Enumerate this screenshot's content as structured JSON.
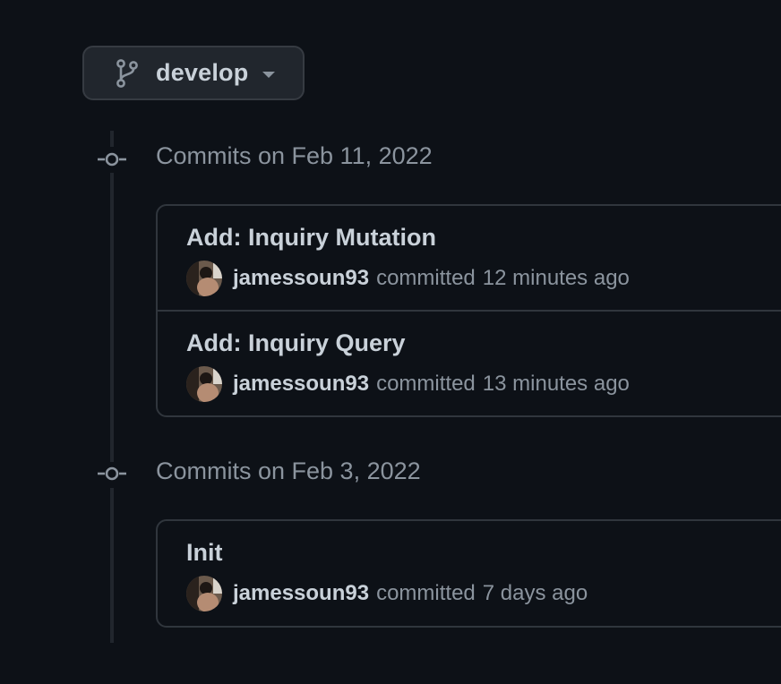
{
  "branch_selector": {
    "label": "develop",
    "icon": "git-branch-icon",
    "caret_icon": "triangle-down-icon"
  },
  "colors": {
    "background": "#0d1117",
    "border": "#30363d",
    "text_primary": "#c9d1d9",
    "text_muted": "#8b949e"
  },
  "commit_groups": [
    {
      "heading": "Commits on Feb 11, 2022",
      "icon": "git-commit-icon",
      "commits": [
        {
          "title": "Add: Inquiry Mutation",
          "author": "jamessoun93",
          "action": "committed",
          "time": "12 minutes ago"
        },
        {
          "title": "Add: Inquiry Query",
          "author": "jamessoun93",
          "action": "committed",
          "time": "13 minutes ago"
        }
      ]
    },
    {
      "heading": "Commits on Feb 3, 2022",
      "icon": "git-commit-icon",
      "commits": [
        {
          "title": "Init",
          "author": "jamessoun93",
          "action": "committed",
          "time": "7 days ago"
        }
      ]
    }
  ]
}
